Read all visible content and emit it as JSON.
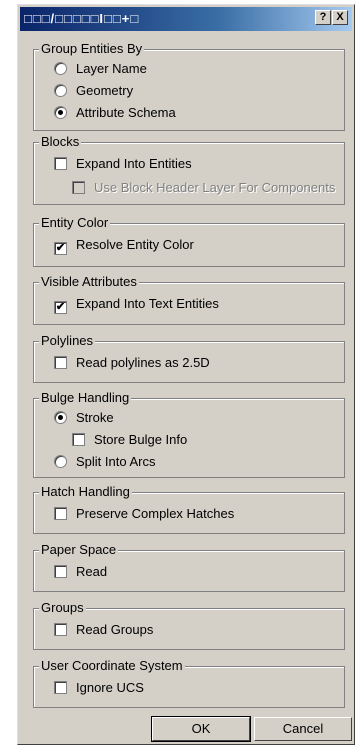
{
  "window": {
    "title": "□□□/□□□□□I□□+□",
    "help_label": "?",
    "close_label": "X"
  },
  "groups": {
    "group_entities": {
      "label": "Group Entities By",
      "layer_name": "Layer Name",
      "geometry": "Geometry",
      "attribute_schema": "Attribute Schema",
      "selected": "Attribute Schema"
    },
    "blocks": {
      "label": "Blocks",
      "expand": "Expand Into Entities",
      "expand_checked": false,
      "use_header": "Use Block Header Layer For Components",
      "use_header_checked": false
    },
    "entity_color": {
      "label": "Entity Color",
      "resolve": "Resolve Entity Color",
      "resolve_checked": true
    },
    "visible_attributes": {
      "label": "Visible Attributes",
      "expand": "Expand Into Text Entities",
      "expand_checked": true
    },
    "polylines": {
      "label": "Polylines",
      "read": "Read polylines as 2.5D",
      "read_checked": false
    },
    "bulge": {
      "label": "Bulge Handling",
      "stroke": "Stroke",
      "store": "Store Bulge Info",
      "store_checked": false,
      "split": "Split Into Arcs",
      "selected": "Stroke"
    },
    "hatch": {
      "label": "Hatch Handling",
      "preserve": "Preserve Complex Hatches",
      "preserve_checked": false
    },
    "paper_space": {
      "label": "Paper Space",
      "read": "Read",
      "read_checked": false
    },
    "groups_section": {
      "label": "Groups",
      "read": "Read Groups",
      "read_checked": false
    },
    "ucs": {
      "label": "User Coordinate System",
      "ignore": "Ignore UCS",
      "ignore_checked": false
    }
  },
  "buttons": {
    "ok": "OK",
    "cancel": "Cancel"
  }
}
